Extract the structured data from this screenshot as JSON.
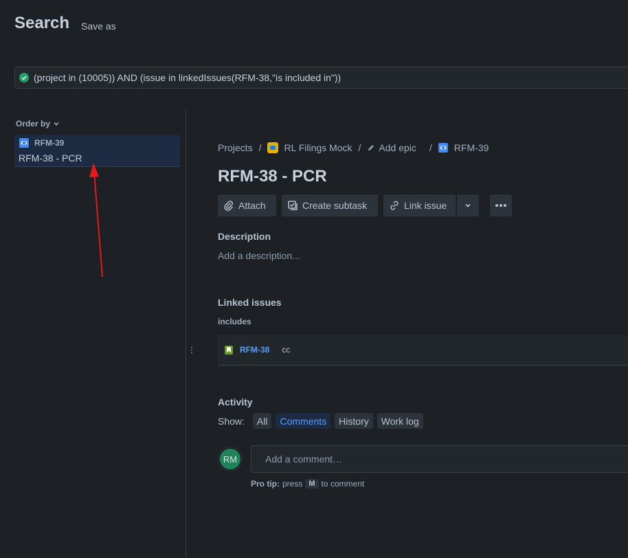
{
  "header": {
    "title": "Search",
    "save_as": "Save as"
  },
  "jql": {
    "query": "(project in (10005)) AND (issue in linkedIssues(RFM-38,\"is included in\"))"
  },
  "results": {
    "order_by_label": "Order by",
    "items": [
      {
        "key": "RFM-39",
        "summary": "RFM-38 - PCR"
      }
    ]
  },
  "breadcrumb": {
    "projects": "Projects",
    "project_name": "RL Filings Mock",
    "add_epic": "Add epic",
    "issue_key": "RFM-39",
    "separator": "/"
  },
  "issue": {
    "title": "RFM-38 - PCR",
    "actions": {
      "attach": "Attach",
      "create_subtask": "Create subtask",
      "link_issue": "Link issue"
    },
    "description": {
      "heading": "Description",
      "placeholder": "Add a description..."
    },
    "linked_issues": {
      "heading": "Linked issues",
      "relation": "includes",
      "items": [
        {
          "key": "RFM-38",
          "summary": "cc"
        }
      ]
    },
    "activity": {
      "heading": "Activity",
      "show_label": "Show:",
      "filters": [
        "All",
        "Comments",
        "History",
        "Work log"
      ],
      "active_filter": "Comments",
      "avatar_initials": "RM",
      "comment_placeholder": "Add a comment…",
      "pro_tip_label": "Pro tip:",
      "pro_tip_press": "press",
      "pro_tip_key": "M",
      "pro_tip_suffix": "to comment"
    }
  },
  "colors": {
    "background": "#1d2125",
    "selected_item": "#1c2b41",
    "link_blue": "#579dff",
    "success_green": "#22a06b",
    "story_icon": "#4688ec",
    "project_icon": "#e2b203",
    "avatar": "#1f845a",
    "annotation_arrow": "#e01b1b"
  },
  "icons": [
    "check-icon",
    "chevron-down-icon",
    "story-icon",
    "project-icon",
    "pencil-icon",
    "paperclip-icon",
    "subtask-icon",
    "link-icon",
    "more-icon",
    "bookmark-icon",
    "drag-handle-icon"
  ]
}
